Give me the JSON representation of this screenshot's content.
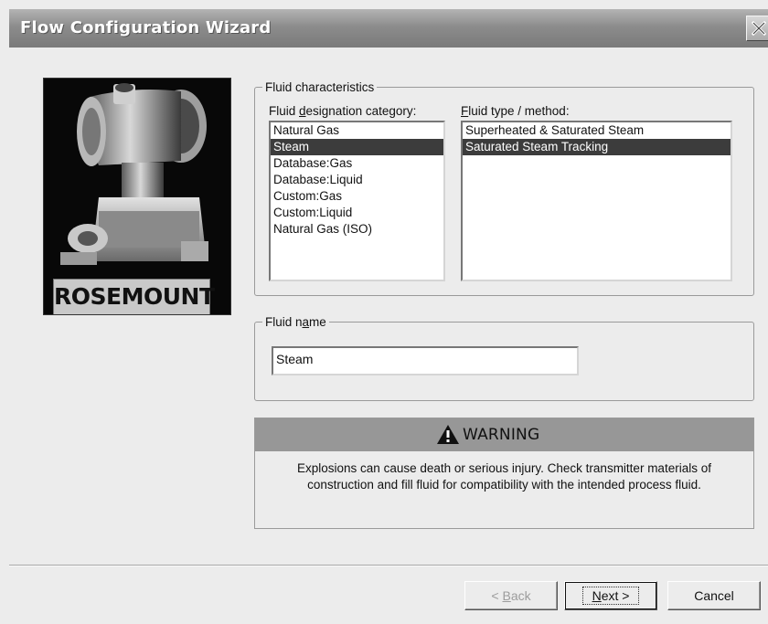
{
  "window": {
    "title": "Flow Configuration Wizard"
  },
  "logo": {
    "brand": "ROSEMOUNT"
  },
  "fluid_characteristics": {
    "legend": "Fluid characteristics",
    "category_label_pre": "Fluid ",
    "category_label_u": "d",
    "category_label_post": "esignation category:",
    "categories": [
      "Natural Gas",
      "Steam",
      "Database:Gas",
      "Database:Liquid",
      "Custom:Gas",
      "Custom:Liquid",
      "Natural Gas (ISO)"
    ],
    "selected_category": "Steam",
    "type_label_u": "F",
    "type_label_post": "luid type / method:",
    "types": [
      "Superheated & Saturated Steam",
      "Saturated Steam Tracking"
    ],
    "selected_type": "Saturated Steam Tracking"
  },
  "fluid_name": {
    "legend_pre": "Fluid n",
    "legend_u": "a",
    "legend_post": "me",
    "value": "Steam"
  },
  "warning": {
    "title": "WARNING",
    "line1": "Explosions can cause death or serious injury. Check transmitter materials of",
    "line2": "construction and fill fluid for compatibility with the intended process fluid."
  },
  "buttons": {
    "back_pre": "< ",
    "back_u": "B",
    "back_post": "ack",
    "next_u": "N",
    "next_post": "ext >",
    "cancel": "Cancel"
  },
  "colors": {
    "titlebar": "#8c8c8c",
    "selection": "#3c3c3c",
    "warning_band": "#979797"
  }
}
